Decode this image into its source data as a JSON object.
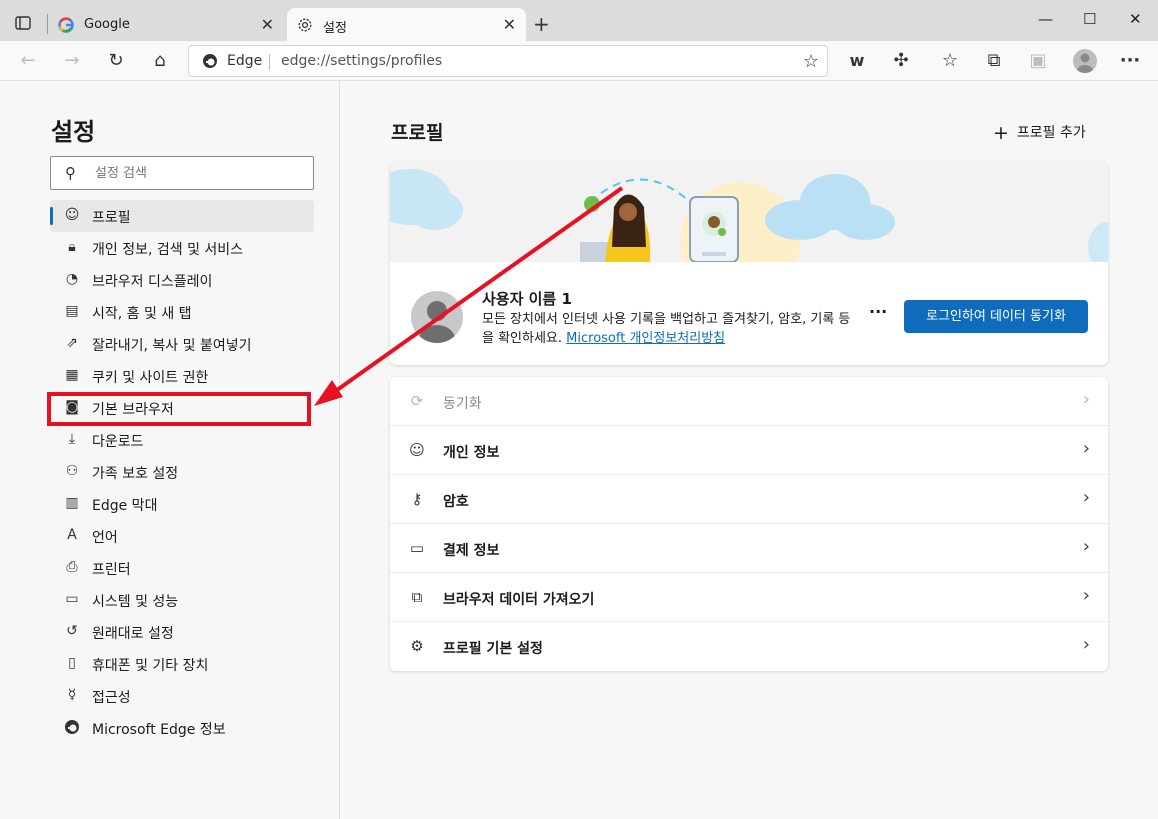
{
  "tabs": [
    {
      "title": "Google",
      "active": false
    },
    {
      "title": "설정",
      "active": true
    }
  ],
  "address": {
    "label": "Edge",
    "url": "edge://settings/profiles"
  },
  "sidebar": {
    "title": "설정",
    "search_placeholder": "설정 검색",
    "items": [
      {
        "label": "프로필",
        "icon": "profile-icon"
      },
      {
        "label": "개인 정보, 검색 및 서비스",
        "icon": "lock-icon"
      },
      {
        "label": "브라우저 디스플레이",
        "icon": "palette-icon"
      },
      {
        "label": "시작, 홈 및 새 탭",
        "icon": "home-tab-icon"
      },
      {
        "label": "잘라내기, 복사 및 붙여넣기",
        "icon": "share-icon"
      },
      {
        "label": "쿠키 및 사이트 권한",
        "icon": "cookie-icon"
      },
      {
        "label": "기본 브라우저",
        "icon": "default-browser-icon"
      },
      {
        "label": "다운로드",
        "icon": "download-icon"
      },
      {
        "label": "가족 보호 설정",
        "icon": "family-icon"
      },
      {
        "label": "Edge 막대",
        "icon": "edge-bar-icon"
      },
      {
        "label": "언어",
        "icon": "language-icon"
      },
      {
        "label": "프린터",
        "icon": "printer-icon"
      },
      {
        "label": "시스템 및 성능",
        "icon": "laptop-icon"
      },
      {
        "label": "원래대로 설정",
        "icon": "reset-icon"
      },
      {
        "label": "휴대폰 및 기타 장치",
        "icon": "phone-icon"
      },
      {
        "label": "접근성",
        "icon": "accessibility-icon"
      },
      {
        "label": "Microsoft Edge 정보",
        "icon": "edge-logo-icon"
      }
    ]
  },
  "main": {
    "title": "프로필",
    "add_profile": "프로필 추가",
    "profile": {
      "name": "사용자 이름 1",
      "desc": "모든 장치에서 인터넷 사용 기록을 백업하고 즐겨찾기, 암호, 기록 등을 확인하세요.",
      "link": "Microsoft 개인정보처리방침",
      "more": "···",
      "sync_button": "로그인하여 데이터 동기화"
    },
    "rows": [
      {
        "label": "동기화",
        "icon": "sync-icon",
        "disabled": true
      },
      {
        "label": "개인 정보",
        "icon": "person-card-icon"
      },
      {
        "label": "암호",
        "icon": "key-icon"
      },
      {
        "label": "결제 정보",
        "icon": "credit-card-icon"
      },
      {
        "label": "브라우저 데이터 가져오기",
        "icon": "import-icon"
      },
      {
        "label": "프로필 기본 설정",
        "icon": "profile-settings-icon"
      }
    ]
  },
  "colors": {
    "accent": "#0f6cbd",
    "annotation_red": "#e81123"
  }
}
